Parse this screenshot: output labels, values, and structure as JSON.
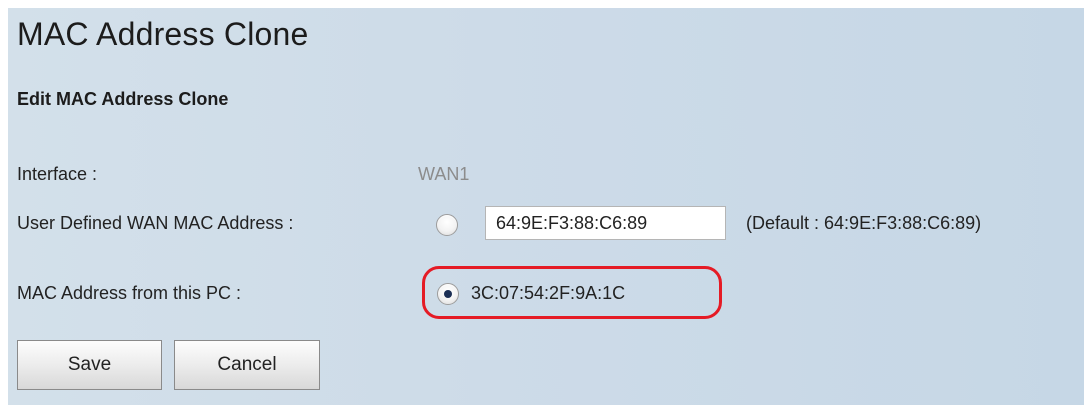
{
  "page": {
    "title": "MAC Address Clone",
    "subtitle": "Edit MAC Address Clone"
  },
  "form": {
    "interface": {
      "label": "Interface :",
      "value": "WAN1"
    },
    "user_defined": {
      "label": "User Defined WAN MAC Address :",
      "selected": false,
      "value": "64:9E:F3:88:C6:89",
      "default_note": "(Default : 64:9E:F3:88:C6:89)"
    },
    "from_pc": {
      "label": "MAC Address from this PC :",
      "selected": true,
      "value": "3C:07:54:2F:9A:1C",
      "highlight_color": "#e51b25"
    }
  },
  "buttons": {
    "save_label": "Save",
    "cancel_label": "Cancel"
  },
  "colors": {
    "panel_bg": "#cddbe8",
    "muted_text": "#8c8c8c",
    "radio_dot": "#1b2f55"
  }
}
